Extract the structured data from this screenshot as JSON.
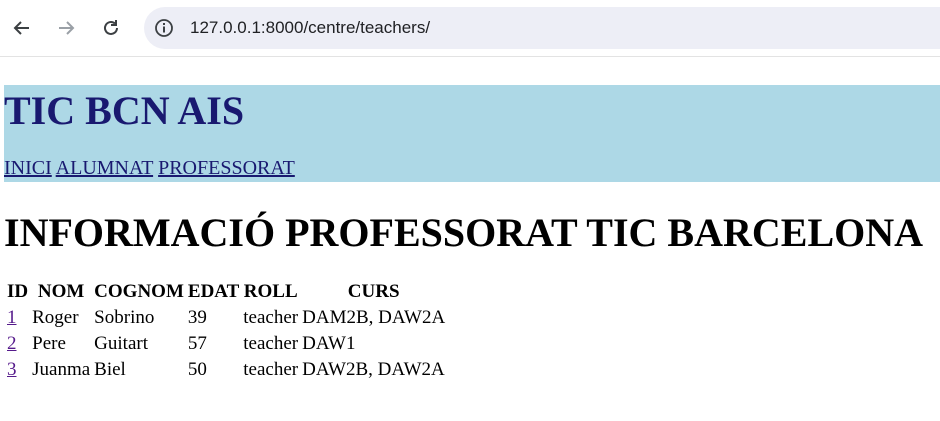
{
  "browser": {
    "url": "127.0.0.1:8000/centre/teachers/",
    "icons": [
      "back-arrow-icon",
      "forward-arrow-icon",
      "reload-icon",
      "site-info-icon"
    ]
  },
  "header": {
    "title": "TIC BCN AIS",
    "nav": [
      "INICI",
      "ALUMNAT",
      "PROFESSORAT"
    ],
    "background": "#add8e6",
    "text_color": "#191970"
  },
  "main": {
    "heading": "INFORMACIÓ PROFESSORAT TIC BARCELONA",
    "table": {
      "headers": [
        "ID",
        "NOM",
        "COGNOM",
        "EDAT",
        "ROLL",
        "CURS"
      ],
      "rows": [
        {
          "id": "1",
          "nom": "Roger",
          "cognom": "Sobrino",
          "edat": "39",
          "roll": "teacher",
          "curs": "DAM2B, DAW2A"
        },
        {
          "id": "2",
          "nom": "Pere",
          "cognom": "Guitart",
          "edat": "57",
          "roll": "teacher",
          "curs": "DAW1"
        },
        {
          "id": "3",
          "nom": "Juanma",
          "cognom": "Biel",
          "edat": "50",
          "roll": "teacher",
          "curs": "DAW2B, DAW2A"
        }
      ]
    }
  }
}
